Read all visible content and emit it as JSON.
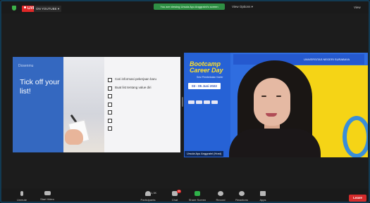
{
  "window": {
    "accent": "#123a52"
  },
  "topbar": {
    "live_badge": "LIVE",
    "stream_label": "ON YOUTUBE ▾",
    "banner_text": "You are viewing Ursula Ayu Anggraini's screen",
    "view_options": "View Options ▾",
    "view_button": "View"
  },
  "slide": {
    "tag": "Dosenmu",
    "title": "Tick off your list!",
    "checklist": [
      "Cari informasi pekerjaan baru",
      "Buat list tentang value diri",
      "",
      "",
      "",
      "",
      ""
    ]
  },
  "video": {
    "event_title": "Bootcamp Career Day",
    "event_subtitle": "Sesi Pembekalan Karier",
    "date": "03 - 05 Juni 2022",
    "strip_text": "UNIVERSITAS NEGERI SURABAYA",
    "participant_name": "Ursula Ayu Anggraini (Host)"
  },
  "toolbar": {
    "items": [
      {
        "label": "Unmute",
        "icon": "microphone-muted-icon"
      },
      {
        "label": "Start Video",
        "icon": "video-off-icon"
      },
      {
        "label": "Participants",
        "icon": "participants-icon",
        "count": "1,3K"
      },
      {
        "label": "Chat",
        "icon": "chat-icon",
        "badge": "99"
      },
      {
        "label": "Share Screen",
        "icon": "share-screen-icon"
      },
      {
        "label": "Record",
        "icon": "record-icon"
      },
      {
        "label": "Reactions",
        "icon": "reactions-icon"
      },
      {
        "label": "Apps",
        "icon": "apps-icon"
      }
    ],
    "leave": "Leave"
  },
  "colors": {
    "live_red": "#e02828",
    "share_green": "#2f8f44",
    "slide_blue": "#3468c0",
    "event_yellow": "#f5d416",
    "event_blue": "#2f6de0"
  }
}
